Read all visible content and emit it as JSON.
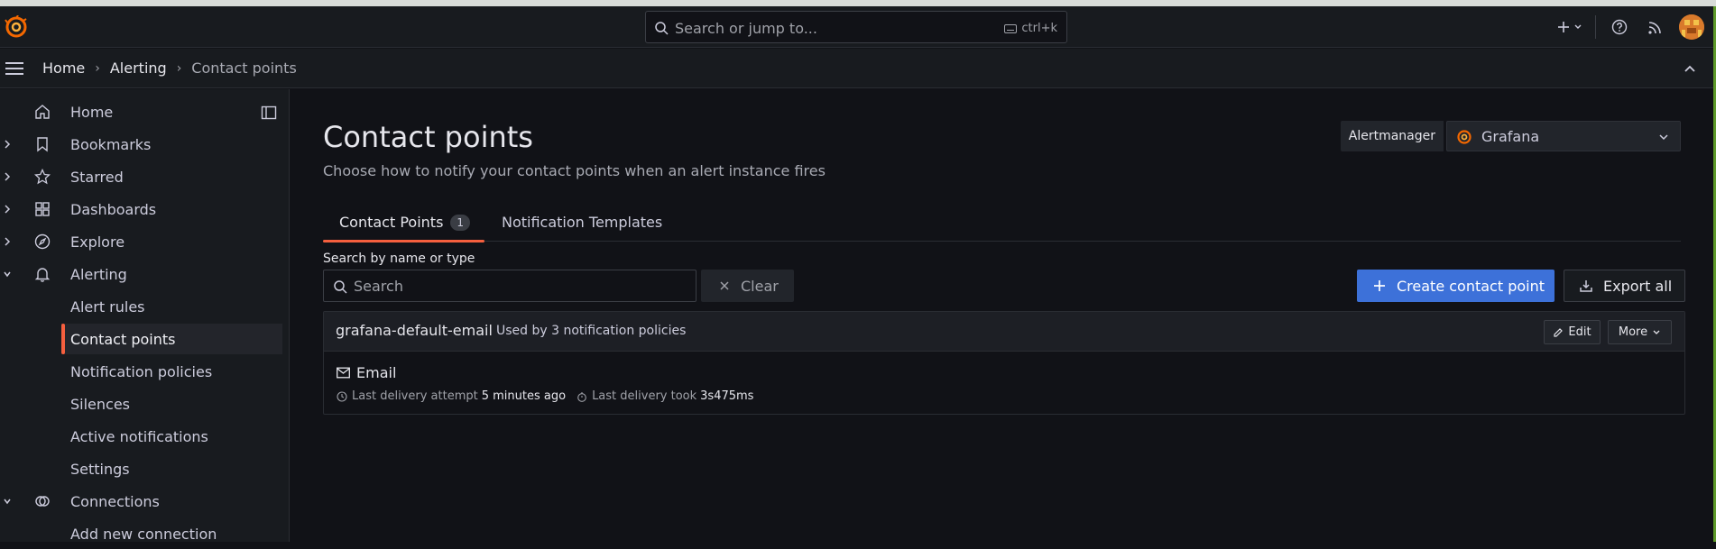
{
  "app": {
    "search_placeholder": "Search or jump to...",
    "search_shortcut": "ctrl+k",
    "accent": "#f55f3e",
    "primary": "#3d71d9"
  },
  "breadcrumb": [
    "Home",
    "Alerting",
    "Contact points"
  ],
  "sidebar": {
    "items": [
      {
        "label": "Home",
        "icon": "home-icon"
      },
      {
        "label": "Bookmarks",
        "icon": "bookmark-icon"
      },
      {
        "label": "Starred",
        "icon": "star-icon"
      },
      {
        "label": "Dashboards",
        "icon": "apps-icon"
      },
      {
        "label": "Explore",
        "icon": "compass-icon"
      },
      {
        "label": "Alerting",
        "icon": "bell-icon"
      }
    ],
    "alerting_children": [
      "Alert rules",
      "Contact points",
      "Notification policies",
      "Silences",
      "Active notifications",
      "Settings"
    ],
    "connections": {
      "label": "Connections",
      "icon": "connections-icon"
    },
    "connections_children": [
      "Add new connection"
    ]
  },
  "page": {
    "title": "Contact points",
    "subtitle": "Choose how to notify your contact points when an alert instance fires",
    "alertmanager_label": "Alertmanager",
    "alertmanager_value": "Grafana"
  },
  "tabs": [
    {
      "label": "Contact Points",
      "count": "1"
    },
    {
      "label": "Notification Templates"
    }
  ],
  "filter": {
    "label": "Search by name or type",
    "placeholder": "Search",
    "clear_label": "Clear",
    "create_label": "Create contact point",
    "export_label": "Export all"
  },
  "contact_point": {
    "name": "grafana-default-email",
    "used_by": "Used by 3 notification policies",
    "edit_label": "Edit",
    "more_label": "More",
    "integration": "Email",
    "last_attempt_label": "Last delivery attempt",
    "last_attempt_value": "5 minutes ago",
    "last_took_label": "Last delivery took",
    "last_took_value": "3s475ms"
  }
}
